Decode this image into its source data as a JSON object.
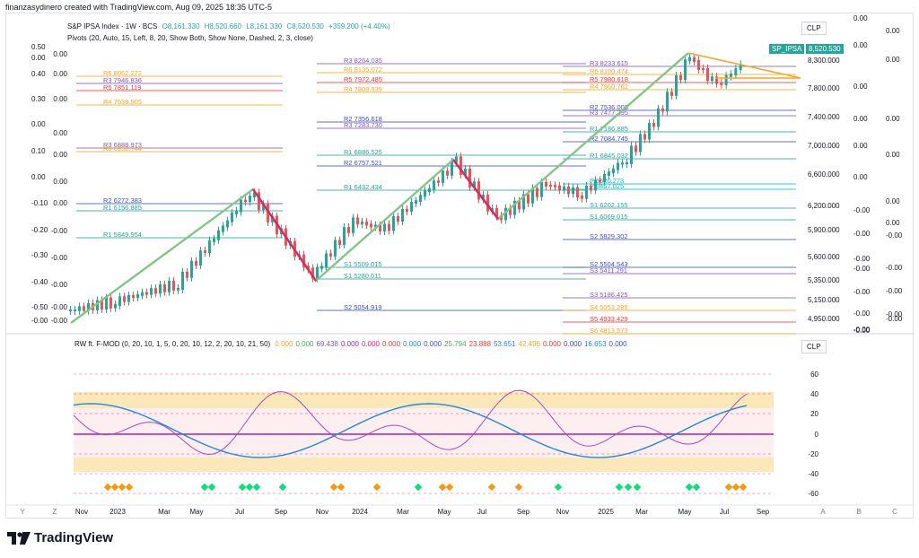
{
  "header": {
    "text": "finanzasydinero created with TradingView.com, Aug 09, 2025 18:35 UTC-5"
  },
  "main_legend": {
    "symbol": "S&P IPSA Index · 1W · BCS",
    "open": "O8,161.330",
    "high": "H8,520.660",
    "low": "L8,161.330",
    "close": "C8,520.530",
    "change": "+359.200 (+4.40%)",
    "pivots": "Pivots (20, Auto, 15, Left, 8, 20, Show Both, Show None, Dashed, 2, 3, close)"
  },
  "currency": "CLP",
  "price_badge": {
    "symbol": "SP_IPSA",
    "value": "8,520.530"
  },
  "price_axis": [
    "8,300.000",
    "7,800.000",
    "7,400.000",
    "7,000.000",
    "6,600.000",
    "6,200.000",
    "5,900.000",
    "5,600.000",
    "5,350.000",
    "5,150.000",
    "4,950.000"
  ],
  "left_axis": [
    "0.50",
    "0.00",
    "0.40",
    "0.30",
    "0.00",
    "0.10",
    "0.00",
    "-0.10",
    "-0.20",
    "-0.30",
    "-0.40",
    "-0.50",
    "-0.00"
  ],
  "left_axis2": [
    "0.00",
    "0.00",
    "0.00",
    "0.00",
    "0.00",
    "0.00",
    "0.00",
    "-0.00",
    "-0.00",
    "-0.00",
    "-0.00",
    "-0.00"
  ],
  "right_axis2": [
    "0.00",
    "0.00",
    "0.00",
    "0.00",
    "0.00",
    "0.00",
    "-0.00",
    "-0.00",
    "-0.00",
    "-0.00",
    "-0.00",
    "-0.00",
    "-0.00",
    "-0.00"
  ],
  "right_axis3": [
    "0.00",
    "0.00",
    "0.00",
    "0.00",
    "0.00",
    "0.00",
    "-0.00",
    "-0.00",
    "-0.00",
    "-0.00",
    "-0.00"
  ],
  "pivot_labels": [
    {
      "t": "R6  8062.272",
      "c": "#f5a623"
    },
    {
      "t": "R3  7946.836",
      "c": "#7e57c2"
    },
    {
      "t": "R5  7851.119",
      "c": "#e53935"
    },
    {
      "t": "R4  7639.905",
      "c": "#f5a623"
    },
    {
      "t": "R3  6888.973",
      "c": "#7e57c2"
    },
    {
      "t": "R6  6950.744",
      "c": "#f5a623"
    },
    {
      "t": "R2  6272.383",
      "c": "#3f51b5"
    },
    {
      "t": "R1  6156.885",
      "c": "#26a69a"
    },
    {
      "t": "R1  5849.954",
      "c": "#26a69a"
    },
    {
      "t": "R3  8264.035",
      "c": "#7e57c2"
    },
    {
      "t": "R6  8135.072",
      "c": "#f5a623"
    },
    {
      "t": "R5  7972.485",
      "c": "#e53935"
    },
    {
      "t": "R4  7809.939",
      "c": "#f5a623"
    },
    {
      "t": "R2  7356.618",
      "c": "#3f51b5"
    },
    {
      "t": "R3  7283.730",
      "c": "#7e57c2"
    },
    {
      "t": "R1  6886.525",
      "c": "#26a69a"
    },
    {
      "t": "R2  6757.521",
      "c": "#3f51b5"
    },
    {
      "t": "R1  6432.434",
      "c": "#26a69a"
    },
    {
      "t": "S1  5509.015",
      "c": "#26a69a"
    },
    {
      "t": "S1  5280.011",
      "c": "#26a69a"
    },
    {
      "t": "S2  5054.919",
      "c": "#3f51b5"
    },
    {
      "t": "R3  8233.615",
      "c": "#7e57c2"
    },
    {
      "t": "R6  8100.474",
      "c": "#f5a623"
    },
    {
      "t": "R5  7980.618",
      "c": "#e53935"
    },
    {
      "t": "R4  7860.762",
      "c": "#f5a623"
    },
    {
      "t": "R2  7536.003",
      "c": "#3f51b5"
    },
    {
      "t": "R3  7477.295",
      "c": "#7e57c2"
    },
    {
      "t": "R1  7186.885",
      "c": "#26a69a"
    },
    {
      "t": "R2  7084.745",
      "c": "#3f51b5"
    },
    {
      "t": "R1  6845.032",
      "c": "#26a69a"
    },
    {
      "t": "P  6520.273",
      "c": "#00bcd4"
    },
    {
      "t": "P  6467.025",
      "c": "#00bcd4"
    },
    {
      "t": "S1  6202.155",
      "c": "#26a69a"
    },
    {
      "t": "S1  6069.015",
      "c": "#26a69a"
    },
    {
      "t": "S2  5829.302",
      "c": "#3f51b5"
    },
    {
      "t": "S2  5504.543",
      "c": "#3f51b5"
    },
    {
      "t": "S3  5411.291",
      "c": "#7e57c2"
    },
    {
      "t": "S3  5186.425",
      "c": "#7e57c2"
    },
    {
      "t": "S4  5053.285",
      "c": "#f5a623"
    },
    {
      "t": "S5  4933.429",
      "c": "#e53935"
    },
    {
      "t": "S6  4813.573",
      "c": "#f5a623"
    }
  ],
  "indicator": {
    "legend_name": "RW ft. F-MOD (0, 20, 10, 1, 5, 0, 20, 10, 12, 2, 20, 10, 21, 50)",
    "values": [
      {
        "v": "0.000",
        "c": "#f5a623"
      },
      {
        "v": "0.000",
        "c": "#4caf50"
      },
      {
        "v": "69.438",
        "c": "#7e57c2"
      },
      {
        "v": "0.000",
        "c": "#9c27b0"
      },
      {
        "v": "0.000",
        "c": "#e91e63"
      },
      {
        "v": "0.000",
        "c": "#e53935"
      },
      {
        "v": "0.000",
        "c": "#1e88e5"
      },
      {
        "v": "0.000",
        "c": "#3f51b5"
      },
      {
        "v": "25.794",
        "c": "#4caf50"
      },
      {
        "v": "23.888",
        "c": "#e53935"
      },
      {
        "v": "53.651",
        "c": "#1e88e5"
      },
      {
        "v": "42.496",
        "c": "#f5a623"
      },
      {
        "v": "0.000",
        "c": "#e53935"
      },
      {
        "v": "0.000",
        "c": "#3f51b5"
      },
      {
        "v": "16.653",
        "c": "#1e88e5"
      },
      {
        "v": "0.000",
        "c": "#3f51b5"
      }
    ],
    "axis": [
      "60",
      "40",
      "20",
      "0",
      "-20",
      "-40",
      "-60"
    ]
  },
  "time_axis": [
    "Nov",
    "2023",
    "Mar",
    "May",
    "Jul",
    "Sep",
    "Nov",
    "2024",
    "Mar",
    "May",
    "Jul",
    "Sep",
    "Nov",
    "2025",
    "Mar",
    "May",
    "Jul",
    "Sep"
  ],
  "bottom_left": [
    "Y",
    "Z"
  ],
  "bottom_right": [
    "A",
    "B",
    "C"
  ],
  "brand": {
    "name": "TradingView"
  },
  "colors": {
    "up": "#26a69a",
    "down": "#ef5350",
    "badge": "#26a69a"
  }
}
